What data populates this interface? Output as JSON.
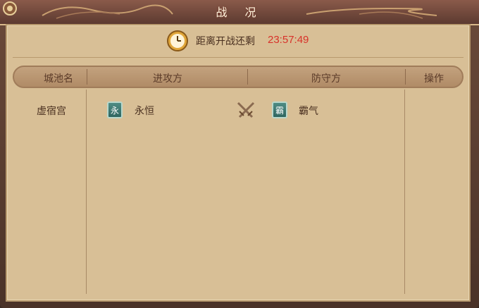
{
  "window": {
    "title": "战 况"
  },
  "timer": {
    "label": "距离开战还剩",
    "value": "23:57:49"
  },
  "table": {
    "headers": {
      "city": "城池名",
      "attacker": "进攻方",
      "defender": "防守方",
      "action": "操作"
    },
    "rows": [
      {
        "city": "虚宿宫",
        "attacker": {
          "badge": "永",
          "name": "永恒"
        },
        "defender": {
          "badge": "霸",
          "name": "霸气"
        }
      }
    ]
  },
  "colors": {
    "timer_value": "#d8322a",
    "badge": "#3b7a72",
    "panel": "#d8bf96"
  }
}
